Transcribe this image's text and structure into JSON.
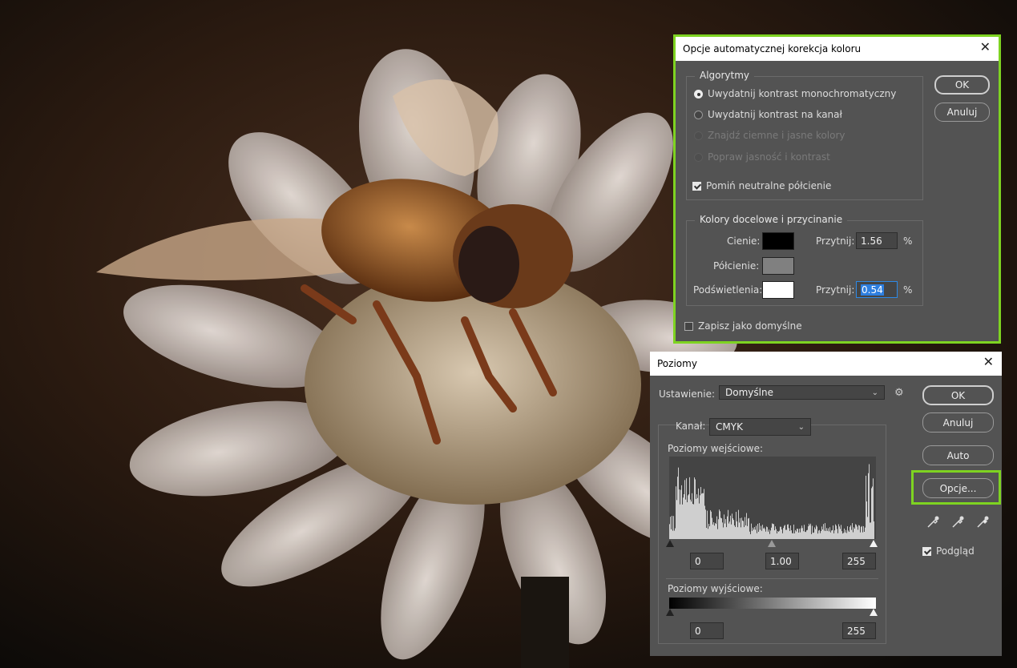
{
  "auto_color_dialog": {
    "title": "Opcje automatycznej korekcja koloru",
    "algorithms_title": "Algorytmy",
    "algorithms": [
      {
        "label": "Uwydatnij kontrast monochromatyczny",
        "selected": true,
        "enabled": true
      },
      {
        "label": "Uwydatnij kontrast na kanał",
        "selected": false,
        "enabled": true
      },
      {
        "label": "Znajdź ciemne i jasne kolory",
        "selected": false,
        "enabled": false
      },
      {
        "label": "Popraw jasność i kontrast",
        "selected": false,
        "enabled": false
      }
    ],
    "snap_neutral_label": "Pomiń neutralne półcienie",
    "snap_neutral_checked": true,
    "targets_title": "Kolory docelowe i przycinanie",
    "shadows_label": "Cienie:",
    "midtones_label": "Półcienie:",
    "highlights_label": "Podświetlenia:",
    "clip_label": "Przytnij:",
    "shadows_clip": "1.56",
    "highlights_clip": "0.54",
    "percent": "%",
    "shadows_color": "#000000",
    "midtones_color": "#808080",
    "highlights_color": "#ffffff",
    "save_default_label": "Zapisz jako domyślne",
    "save_default_checked": false,
    "ok_label": "OK",
    "cancel_label": "Anuluj"
  },
  "levels_dialog": {
    "title": "Poziomy",
    "preset_label": "Ustawienie:",
    "preset_value": "Domyślne",
    "channel_label": "Kanał:",
    "channel_value": "CMYK",
    "input_levels_label": "Poziomy wejściowe:",
    "input_black": "0",
    "input_gamma": "1.00",
    "input_white": "255",
    "output_levels_label": "Poziomy wyjściowe:",
    "output_black": "0",
    "output_white": "255",
    "ok_label": "OK",
    "cancel_label": "Anuluj",
    "auto_label": "Auto",
    "options_label": "Opcje...",
    "preview_label": "Podgląd",
    "preview_checked": true
  },
  "colors": {
    "highlight": "#7ed321",
    "dialog_bg": "#535353"
  },
  "icons": [
    "close-icon",
    "gear-icon",
    "chevron-down-icon",
    "black-eyedropper-icon",
    "gray-eyedropper-icon",
    "white-eyedropper-icon"
  ]
}
